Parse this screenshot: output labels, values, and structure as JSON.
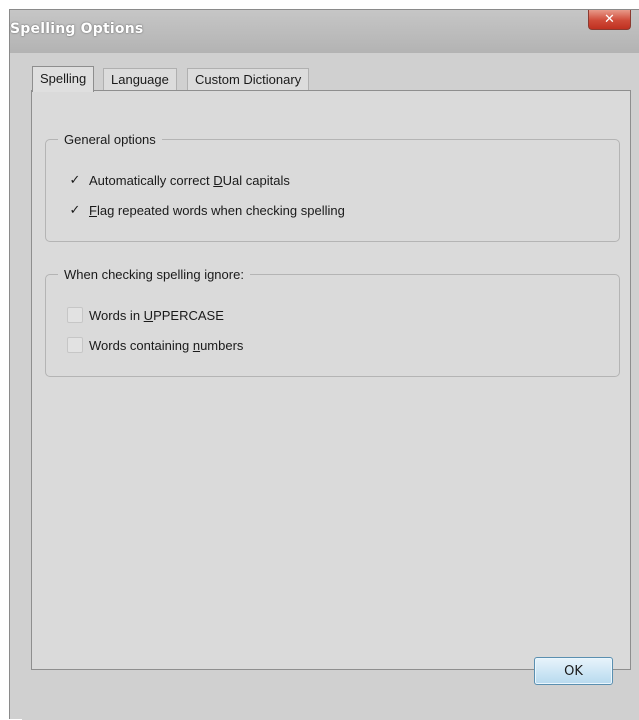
{
  "window": {
    "title": "Spelling Options",
    "close_glyph": "✕"
  },
  "tabs": [
    {
      "label": "Spelling",
      "active": true
    },
    {
      "label": "Language",
      "active": false
    },
    {
      "label": "Custom Dictionary",
      "active": false
    }
  ],
  "general_options": {
    "legend": "General options",
    "items": [
      {
        "pre": "Automatically correct ",
        "mnemonic": "D",
        "post": "Ual capitals",
        "checked": true
      },
      {
        "pre": "",
        "mnemonic": "F",
        "post": "lag repeated words when checking spelling",
        "checked": true
      }
    ]
  },
  "ignore_options": {
    "legend": "When checking spelling ignore:",
    "items": [
      {
        "pre": "Words in ",
        "mnemonic": "U",
        "post": "PPERCASE",
        "checked": false
      },
      {
        "pre": "Words containing ",
        "mnemonic": "n",
        "post": "umbers",
        "checked": false
      }
    ]
  },
  "buttons": {
    "ok_label": "OK"
  },
  "icons": {
    "check": "✓"
  },
  "colors": {
    "ok_accent": "#5a8fb0",
    "close_red": "#c03020"
  }
}
